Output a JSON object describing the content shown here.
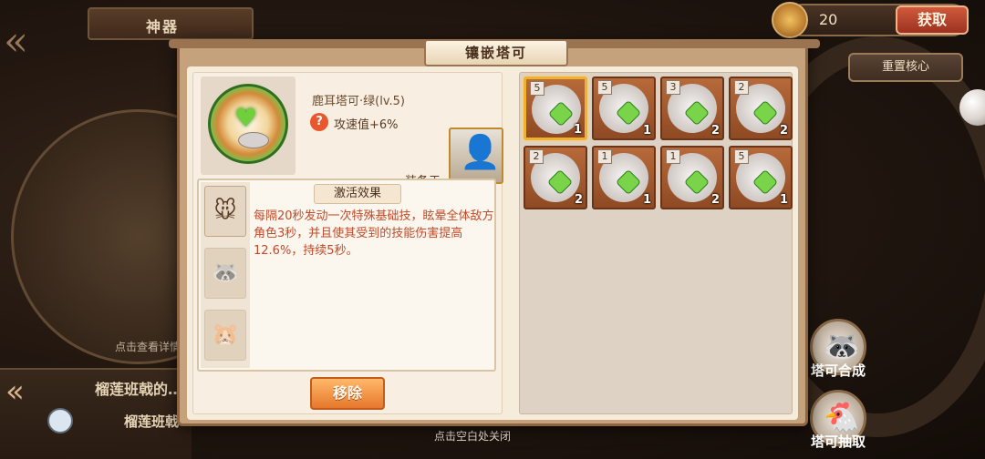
{
  "background": {
    "panel_title": "神器",
    "hint": "点击查看详情",
    "banner_title": "榴莲班戟的…",
    "banner_subtitle": "榴莲班戟"
  },
  "currency": {
    "value": "20",
    "get_label": "获取"
  },
  "reset_label": "重置核心",
  "side_buttons": [
    {
      "label": "塔可合成",
      "icon": "raccoon-icon"
    },
    {
      "label": "塔可抽取",
      "icon": "chicken-icon"
    }
  ],
  "close_hint": "点击空白处关闭",
  "dialog": {
    "title": "镶嵌塔可",
    "item": {
      "name": "鹿耳塔可·绿(lv.5)",
      "stat": "攻速值+6%",
      "equipped_label": "装备于"
    },
    "effect": {
      "tab_label": "激活效果",
      "text": "每隔20秒发动一次特殊基础技，眩晕全体敌方角色3秒，并且使其受到的技能伤害提高12.6%，持续5秒。"
    },
    "remove_label": "移除",
    "grid": [
      {
        "level": "5",
        "count": "1",
        "selected": true
      },
      {
        "level": "5",
        "count": "1",
        "selected": false
      },
      {
        "level": "3",
        "count": "2",
        "selected": false
      },
      {
        "level": "2",
        "count": "2",
        "selected": false
      },
      {
        "level": "2",
        "count": "2",
        "selected": false
      },
      {
        "level": "1",
        "count": "1",
        "selected": false
      },
      {
        "level": "1",
        "count": "2",
        "selected": false
      },
      {
        "level": "5",
        "count": "1",
        "selected": false
      }
    ]
  }
}
